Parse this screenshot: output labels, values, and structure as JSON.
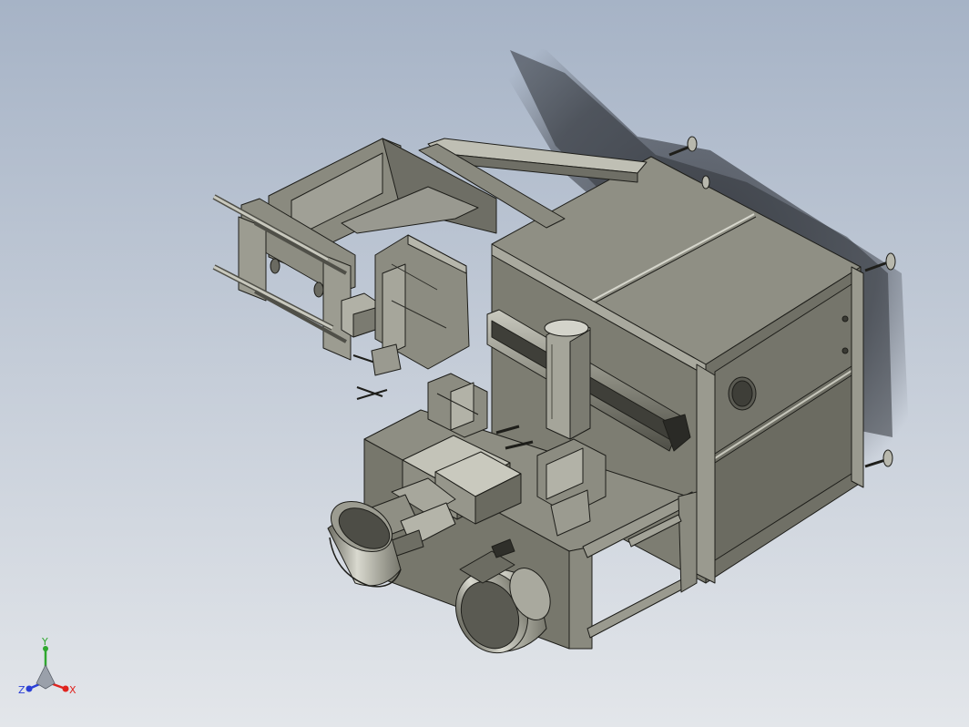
{
  "viewport": {
    "background_top": "#a7b4c7",
    "background_bottom": "#e2e6ea",
    "model_color": "#8b8b7e",
    "model_dark": "#5e5e54",
    "model_light": "#b9b9ad",
    "edge_color": "#1e1e1a"
  },
  "triad": {
    "x_label": "X",
    "y_label": "Y",
    "z_label": "Z",
    "x_color": "#e0241f",
    "y_color": "#2fa82f",
    "z_color": "#2a3fd6"
  }
}
